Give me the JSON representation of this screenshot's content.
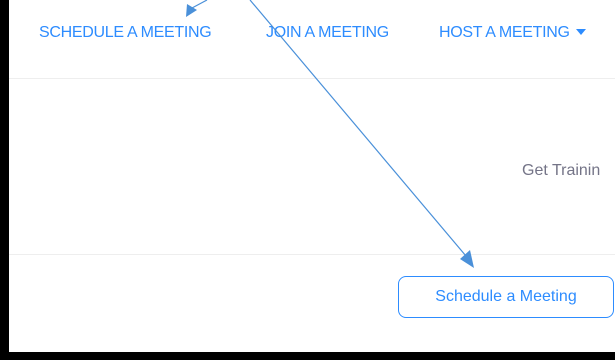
{
  "topnav": {
    "schedule_label": "SCHEDULE A MEETING",
    "join_label": "JOIN A MEETING",
    "host_label": "HOST A MEETING"
  },
  "main": {
    "training_text": "Get Trainin",
    "schedule_button_label": "Schedule a Meeting"
  },
  "colors": {
    "accent": "#2d8cff",
    "annotation_arrow": "#4a90d9",
    "muted_text": "#747487",
    "frame_border": "#000000"
  }
}
